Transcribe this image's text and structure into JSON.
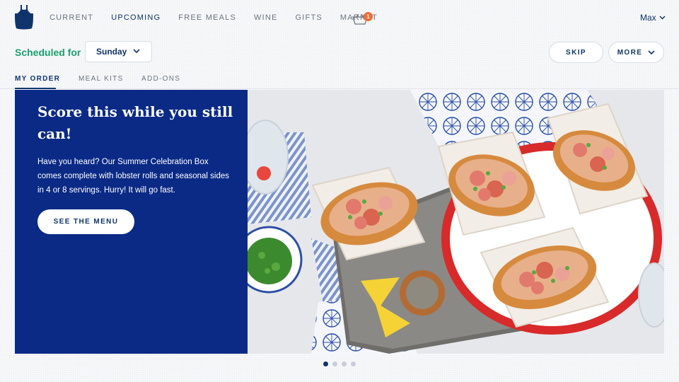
{
  "nav": {
    "links": [
      {
        "label": "CURRENT",
        "active": false
      },
      {
        "label": "UPCOMING",
        "active": true
      },
      {
        "label": "FREE MEALS",
        "active": false
      },
      {
        "label": "WINE",
        "active": false
      },
      {
        "label": "GIFTS",
        "active": false
      },
      {
        "label": "MARKET",
        "active": false
      }
    ],
    "cart_count": "1",
    "user_name": "Max"
  },
  "schedule": {
    "label": "Scheduled for",
    "day": "Sunday",
    "skip_label": "SKIP",
    "more_label": "MORE"
  },
  "tabs": [
    {
      "label": "MY ORDER",
      "active": true
    },
    {
      "label": "MEAL KITS",
      "active": false
    },
    {
      "label": "ADD-ONS",
      "active": false
    }
  ],
  "hero": {
    "title": "Score this while you still can!",
    "text": "Have you heard? Our Summer Celebration Box comes complete with lobster rolls and seasonal sides in 4 or 8 servings. Hurry! It will go fast.",
    "button_label": "SEE THE MENU",
    "image_icon": "lobster-rolls-photo"
  },
  "carousel": {
    "count": 4,
    "active_index": 0
  },
  "colors": {
    "brand_navy": "#0f346c",
    "hero_blue": "#0a2a86",
    "schedule_green": "#1aa06b",
    "badge_orange": "#f26b34"
  }
}
